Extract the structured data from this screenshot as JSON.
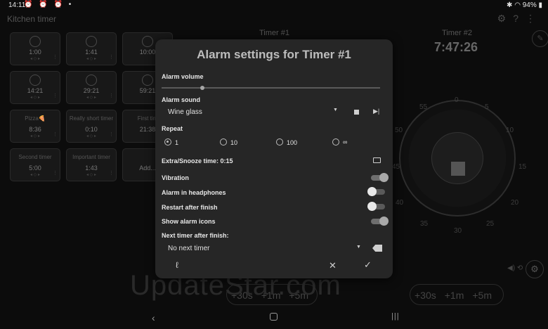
{
  "status": {
    "time": "14:11",
    "icons": "⏰ ⏰ ⏰ •",
    "battery": "94%"
  },
  "app": {
    "title": "Kitchen timer"
  },
  "tiles": [
    {
      "time": "1:00",
      "name": ""
    },
    {
      "time": "1:41",
      "name": ""
    },
    {
      "time": "10:00",
      "name": ""
    },
    {
      "time": "14:21",
      "name": ""
    },
    {
      "time": "29:21",
      "name": ""
    },
    {
      "time": "59:21",
      "name": ""
    },
    {
      "time": "8:36",
      "name": "Pizza🍕"
    },
    {
      "time": "0:10",
      "name": "Really short timer"
    },
    {
      "time": "21:38",
      "name": "First tim"
    },
    {
      "time": "5:00",
      "name": "Second timer"
    },
    {
      "time": "1:43",
      "name": "Important timer"
    },
    {
      "time": "Add...",
      "name": ""
    }
  ],
  "timer1": {
    "label": "Timer #1"
  },
  "timer2": {
    "label": "Timer #2",
    "time": "7:47:26"
  },
  "dial_numbers": [
    "0",
    "5",
    "10",
    "15",
    "20",
    "25",
    "30",
    "35",
    "40",
    "45",
    "50",
    "55"
  ],
  "pills": {
    "a": "+30s",
    "b": "+1m",
    "c": "+5m"
  },
  "watermark": "UpdateStar.com",
  "dialog": {
    "title": "Alarm settings for Timer #1",
    "alarm_volume_label": "Alarm volume",
    "alarm_volume_level": 0.18,
    "alarm_sound_label": "Alarm sound",
    "alarm_sound_value": "Wine glass",
    "repeat_label": "Repeat",
    "repeat_options": [
      "1",
      "10",
      "100",
      "∞"
    ],
    "repeat_selected": "1",
    "snooze_label": "Extra/Snooze time: 0:15",
    "vibration_label": "Vibration",
    "alarm_headphones_label": "Alarm in headphones",
    "restart_label": "Restart after finish",
    "show_icons_label": "Show alarm icons",
    "next_timer_label": "Next timer after finish:",
    "next_timer_value": "No next timer"
  }
}
